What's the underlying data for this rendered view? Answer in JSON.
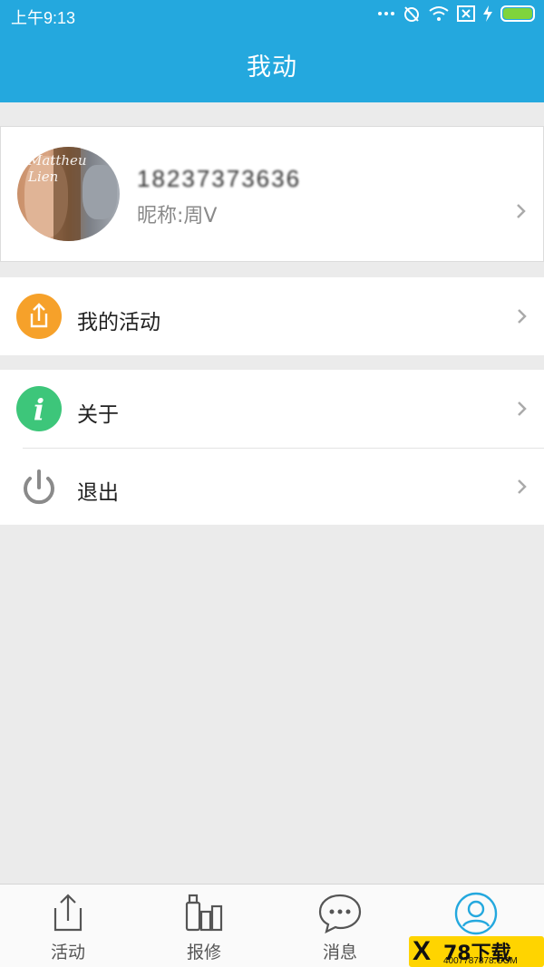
{
  "status_bar": {
    "time": "上午9:13"
  },
  "header": {
    "title": "我动"
  },
  "profile": {
    "phone": "18237373636",
    "nickname": "昵称:周V",
    "avatar_text": "Mattheu Lien"
  },
  "menu": {
    "my_activities": "我的活动",
    "about": "关于",
    "logout": "退出"
  },
  "tabs": [
    {
      "label": "活动",
      "icon": "share-icon"
    },
    {
      "label": "报修",
      "icon": "repair-icon"
    },
    {
      "label": "消息",
      "icon": "message-icon"
    },
    {
      "label": "",
      "icon": "person-icon"
    }
  ],
  "watermark": {
    "brand": "78下载",
    "url": "4007787878.COM"
  },
  "colors": {
    "primary": "#24a8de",
    "activity_icon": "#f6a12a",
    "about_icon": "#3dc67a",
    "logout_icon": "#8a8a8a"
  }
}
